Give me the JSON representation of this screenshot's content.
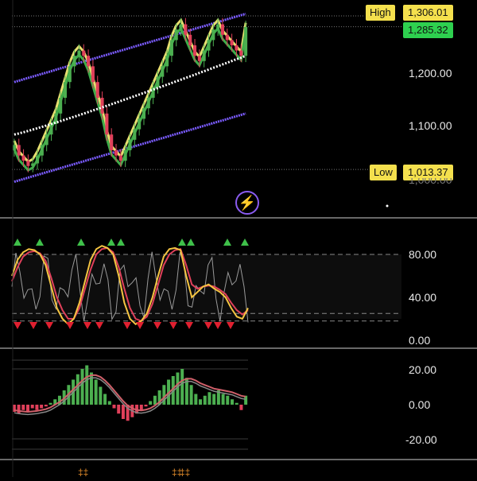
{
  "colors": {
    "bull": "#4caf50",
    "bear": "#e0405a",
    "band": "#7b5cff",
    "yellow_band": "#e8e070",
    "green_band": "#3fae4a",
    "ma_white": "#ffffff",
    "stoch_k": "#f5c542",
    "stoch_d": "#e0405a",
    "rsi_line": "#9a9a9a",
    "macd_hist_pos": "#4caf50",
    "macd_hist_neg": "#e0405a",
    "macd_signal": "#d0606a",
    "tag_yellow": "#f4e04d",
    "tag_green": "#2ed04f",
    "divider": "#8a8a8a"
  },
  "price_pane": {
    "high_label": "High",
    "high_value": "1,306.01",
    "last_value": "1,285.32",
    "low_label": "Low",
    "low_value": "1,013.37",
    "axis_labels": [
      "1,200.00",
      "1,100.00",
      "1,000.00"
    ],
    "icon": "lightning-icon"
  },
  "stoch_pane": {
    "axis_labels": [
      "80.00",
      "40.00",
      "0.00"
    ]
  },
  "macd_pane": {
    "axis_labels": [
      "20.00",
      "0.00",
      "-20.00"
    ]
  },
  "chart_data": [
    {
      "type": "candlestick",
      "title": "",
      "ylim": [
        1000,
        1320
      ],
      "high": 1306.01,
      "low": 1013.37,
      "last": 1285.32,
      "closes": [
        1060,
        1040,
        1030,
        1020,
        1025,
        1040,
        1060,
        1080,
        1100,
        1120,
        1150,
        1180,
        1210,
        1230,
        1240,
        1230,
        1210,
        1180,
        1150,
        1120,
        1080,
        1050,
        1040,
        1030,
        1050,
        1070,
        1090,
        1110,
        1130,
        1150,
        1170,
        1190,
        1210,
        1230,
        1260,
        1280,
        1290,
        1270,
        1250,
        1230,
        1220,
        1240,
        1260,
        1280,
        1290,
        1270,
        1260,
        1250,
        1240,
        1230,
        1285
      ]
    },
    {
      "type": "line",
      "ylim": [
        0,
        100
      ],
      "series": [
        {
          "values": [
            60,
            75,
            82,
            85,
            84,
            80,
            70,
            50,
            30,
            20,
            15,
            20,
            35,
            55,
            75,
            85,
            88,
            86,
            80,
            60,
            35,
            20,
            15,
            18,
            25,
            40,
            60,
            78,
            85,
            86,
            84,
            60,
            40,
            45,
            50,
            52,
            48,
            45,
            40,
            30,
            22,
            20,
            30
          ]
        },
        {
          "values": [
            55,
            68,
            78,
            82,
            83,
            81,
            74,
            58,
            40,
            28,
            20,
            20,
            30,
            48,
            66,
            80,
            85,
            86,
            82,
            68,
            48,
            30,
            20,
            18,
            22,
            34,
            52,
            70,
            80,
            84,
            85,
            70,
            52,
            48,
            50,
            51,
            50,
            47,
            43,
            35,
            28,
            24,
            28
          ]
        }
      ]
    },
    {
      "type": "bar",
      "ylim": [
        -25,
        25
      ],
      "values": [
        -4,
        -5,
        -3,
        -4,
        -2,
        -3,
        -2,
        -1,
        1,
        3,
        5,
        8,
        11,
        14,
        17,
        20,
        22,
        18,
        14,
        10,
        6,
        2,
        -2,
        -5,
        -8,
        -9,
        -7,
        -5,
        -3,
        -1,
        2,
        5,
        8,
        11,
        14,
        16,
        18,
        20,
        15,
        11,
        6,
        3,
        5,
        7,
        6,
        8,
        6,
        5,
        3,
        1,
        -3,
        5
      ],
      "signal": [
        -3,
        -3.5,
        -3.8,
        -4,
        -3.8,
        -3.5,
        -3,
        -2.5,
        -1.5,
        0,
        1.5,
        3.5,
        6,
        8.5,
        11,
        13.5,
        15.5,
        16.5,
        16.5,
        15.5,
        13.5,
        11,
        8,
        5,
        2,
        -0.5,
        -2,
        -3,
        -3.2,
        -2.8,
        -2,
        -0.5,
        1.5,
        4,
        6.5,
        9,
        11.5,
        13.5,
        14.5,
        14.5,
        13.5,
        12,
        11,
        10,
        9,
        8.5,
        8,
        7.5,
        7,
        6,
        5,
        4.5
      ]
    }
  ]
}
